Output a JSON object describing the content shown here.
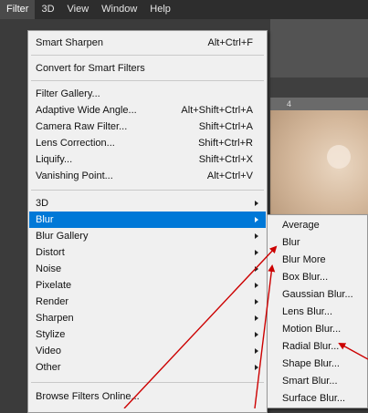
{
  "menubar": {
    "items": [
      "Filter",
      "3D",
      "View",
      "Window",
      "Help"
    ],
    "active_index": 0
  },
  "ruler": {
    "tick": "4"
  },
  "filter_menu": {
    "items": [
      {
        "label": "Smart Sharpen",
        "shortcut": "Alt+Ctrl+F"
      },
      {
        "label": "Convert for Smart Filters",
        "shortcut": ""
      },
      {
        "label": "Filter Gallery...",
        "shortcut": ""
      },
      {
        "label": "Adaptive Wide Angle...",
        "shortcut": "Alt+Shift+Ctrl+A"
      },
      {
        "label": "Camera Raw Filter...",
        "shortcut": "Shift+Ctrl+A"
      },
      {
        "label": "Lens Correction...",
        "shortcut": "Shift+Ctrl+R"
      },
      {
        "label": "Liquify...",
        "shortcut": "Shift+Ctrl+X"
      },
      {
        "label": "Vanishing Point...",
        "shortcut": "Alt+Ctrl+V"
      },
      {
        "label": "3D",
        "shortcut": ""
      },
      {
        "label": "Blur",
        "shortcut": ""
      },
      {
        "label": "Blur Gallery",
        "shortcut": ""
      },
      {
        "label": "Distort",
        "shortcut": ""
      },
      {
        "label": "Noise",
        "shortcut": ""
      },
      {
        "label": "Pixelate",
        "shortcut": ""
      },
      {
        "label": "Render",
        "shortcut": ""
      },
      {
        "label": "Sharpen",
        "shortcut": ""
      },
      {
        "label": "Stylize",
        "shortcut": ""
      },
      {
        "label": "Video",
        "shortcut": ""
      },
      {
        "label": "Other",
        "shortcut": ""
      },
      {
        "label": "Browse Filters Online...",
        "shortcut": ""
      }
    ],
    "selected_index": 9,
    "selection_color": "#0078d7"
  },
  "blur_submenu": {
    "items": [
      "Average",
      "Blur",
      "Blur More",
      "Box Blur...",
      "Gaussian Blur...",
      "Lens Blur...",
      "Motion Blur...",
      "Radial Blur...",
      "Shape Blur...",
      "Smart Blur...",
      "Surface Blur..."
    ]
  },
  "annotation_color": "#cc0000"
}
